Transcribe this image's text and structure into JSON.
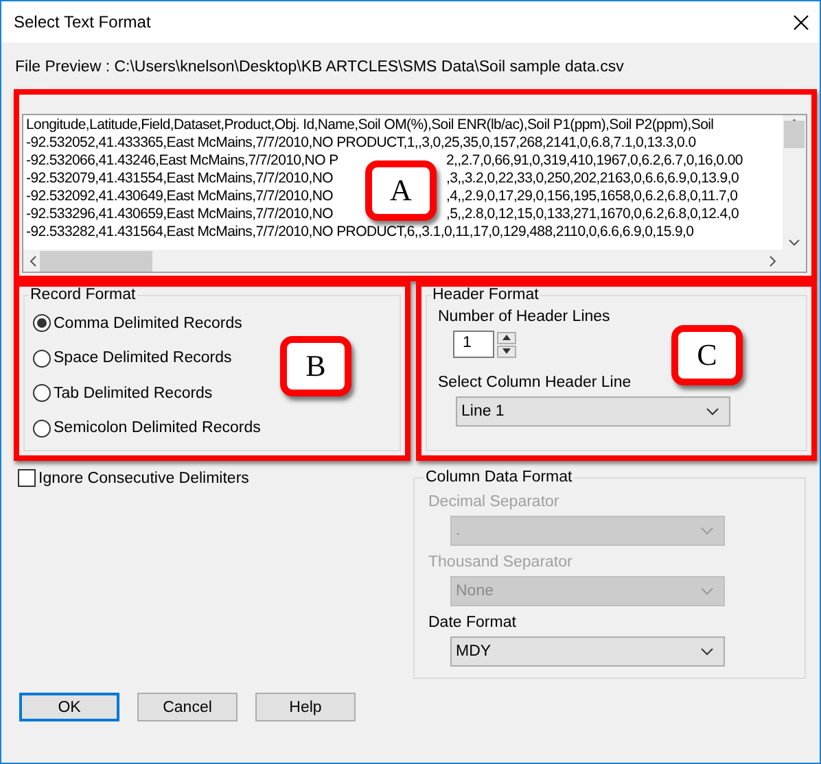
{
  "window": {
    "title": "Select Text Format"
  },
  "file_preview": {
    "label": "File Preview : C:\\Users\\knelson\\Desktop\\KB ARTCLES\\SMS Data\\Soil sample data.csv",
    "lines": [
      {
        "segments": [
          "Longitude,Latitude,Field,Dataset,Product,Obj. Id,Name,Soil OM(%),Soil ENR(lb/ac),Soil P1(ppm),Soil P2(ppm),Soil"
        ]
      },
      {
        "segments": [
          "-92.532052,41.433365,East McMains,7/7/2010,NO PRODUCT,1,,3,0,25,35,0,157,268,2141,0,6.8,7.1,0,13.3,0.0"
        ]
      },
      {
        "segments": [
          "-92.532066,41.43246,East McMains,7/7/2010,NO P",
          "2,,2.7,0,66,91,0,319,410,1967,0,6.2,6.7,0,16,0.00"
        ]
      },
      {
        "segments": [
          "-92.532079,41.431554,East McMains,7/7/2010,NO",
          ",3,,3.2,0,22,33,0,250,202,2163,0,6.6,6.9,0,13.9,0"
        ]
      },
      {
        "segments": [
          "-92.532092,41.430649,East McMains,7/7/2010,NO",
          ",4,,2.9,0,17,29,0,156,195,1658,0,6.2,6.8,0,11.7,0"
        ]
      },
      {
        "segments": [
          "-92.533296,41.430659,East McMains,7/7/2010,NO",
          ",5,,2.8,0,12,15,0,133,271,1670,0,6.2,6.8,0,12.4,0"
        ]
      },
      {
        "segments": [
          "-92.533282,41.431564,East McMains,7/7/2010,NO PRODUCT,6,,3.1,0,11,17,0,129,488,2110,0,6.6,6.9,0,15.9,0"
        ]
      }
    ]
  },
  "record_format": {
    "title": "Record Format",
    "options": [
      {
        "label": "Comma Delimited Records",
        "selected": true
      },
      {
        "label": "Space Delimited Records",
        "selected": false
      },
      {
        "label": "Tab Delimited Records",
        "selected": false
      },
      {
        "label": "Semicolon Delimited Records",
        "selected": false
      }
    ]
  },
  "header_format": {
    "title": "Header Format",
    "header_lines_label": "Number of Header Lines",
    "header_lines": "1",
    "column_header_label": "Select Column Header Line",
    "column_header": "Line 1"
  },
  "ignore_consecutive": {
    "label": "Ignore Consecutive Delimiters",
    "checked": false
  },
  "column_data_format": {
    "title": "Column Data Format",
    "fields": [
      {
        "label": "Decimal Separator",
        "value": ".",
        "disabled": true
      },
      {
        "label": "Thousand Separator",
        "value": "None",
        "disabled": true
      },
      {
        "label": "Date Format",
        "value": "MDY",
        "disabled": false
      }
    ]
  },
  "buttons": [
    {
      "label": "OK",
      "default": true
    },
    {
      "label": "Cancel",
      "default": false
    },
    {
      "label": "Help",
      "default": false
    }
  ],
  "callouts": [
    {
      "label": "A"
    },
    {
      "label": "B"
    },
    {
      "label": "C"
    }
  ]
}
